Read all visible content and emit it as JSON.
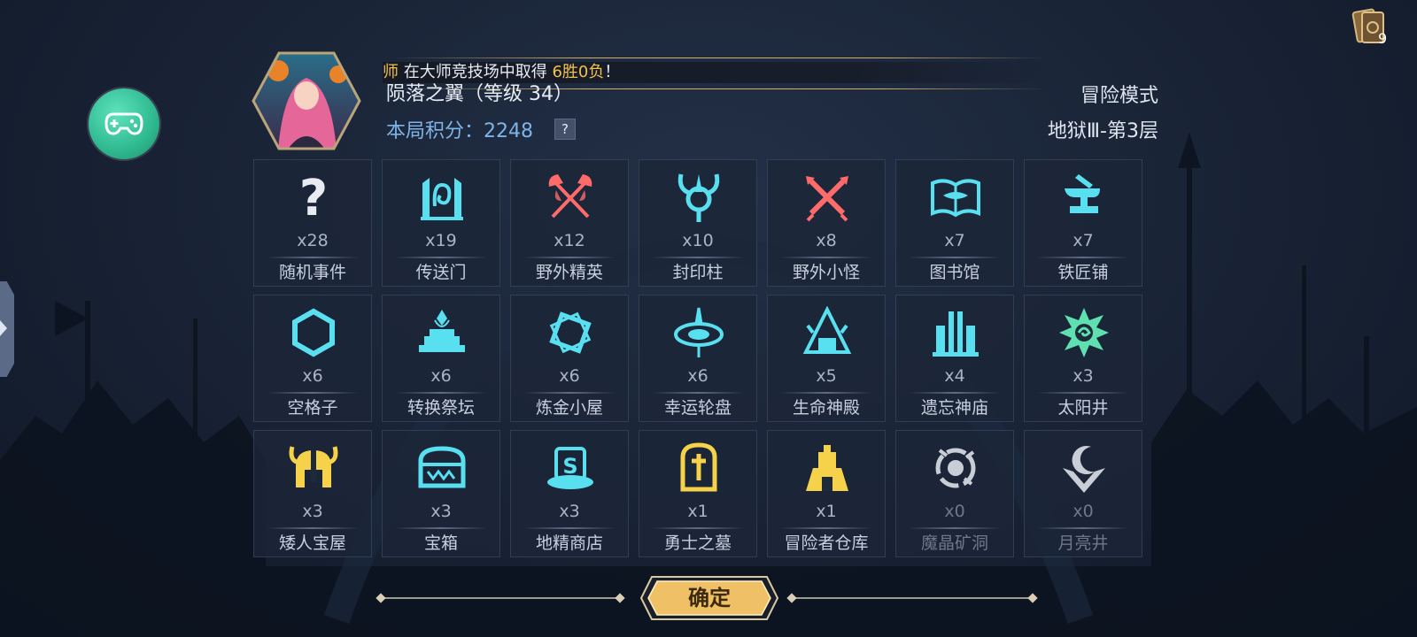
{
  "notification": {
    "prefix": "师",
    "text_mid": " 在大师竞技场中取得 ",
    "result": "6胜0负",
    "suffix": "！"
  },
  "header": {
    "title": "陨落之翼（等级 34）",
    "score_label": "本局积分：2248",
    "help_label": "?",
    "mode": "冒险模式",
    "floor": "地狱Ⅲ-第3层"
  },
  "top_right": {
    "card_count": "9",
    "icon": "card-deck-icon"
  },
  "tiles": [
    {
      "count": "x28",
      "name": "随机事件",
      "icon": "question-icon"
    },
    {
      "count": "x19",
      "name": "传送门",
      "icon": "portal-icon"
    },
    {
      "count": "x12",
      "name": "野外精英",
      "icon": "crossed-axes-icon"
    },
    {
      "count": "x10",
      "name": "封印柱",
      "icon": "seal-pillar-icon"
    },
    {
      "count": "x8",
      "name": "野外小怪",
      "icon": "crossed-swords-icon"
    },
    {
      "count": "x7",
      "name": "图书馆",
      "icon": "book-icon"
    },
    {
      "count": "x7",
      "name": "铁匠铺",
      "icon": "anvil-icon"
    },
    {
      "count": "x6",
      "name": "空格子",
      "icon": "hexagon-icon"
    },
    {
      "count": "x6",
      "name": "转换祭坛",
      "icon": "altar-icon"
    },
    {
      "count": "x6",
      "name": "炼金小屋",
      "icon": "alchemy-icon"
    },
    {
      "count": "x6",
      "name": "幸运轮盘",
      "icon": "roulette-icon"
    },
    {
      "count": "x5",
      "name": "生命神殿",
      "icon": "life-temple-icon"
    },
    {
      "count": "x4",
      "name": "遗忘神庙",
      "icon": "forgotten-temple-icon"
    },
    {
      "count": "x3",
      "name": "太阳井",
      "icon": "sun-well-icon"
    },
    {
      "count": "x3",
      "name": "矮人宝屋",
      "icon": "dwarf-helmet-icon"
    },
    {
      "count": "x3",
      "name": "宝箱",
      "icon": "chest-icon"
    },
    {
      "count": "x3",
      "name": "地精商店",
      "icon": "goblin-shop-icon"
    },
    {
      "count": "x1",
      "name": "勇士之墓",
      "icon": "tombstone-icon"
    },
    {
      "count": "x1",
      "name": "冒险者仓库",
      "icon": "warehouse-icon"
    },
    {
      "count": "x0",
      "name": "魔晶矿洞",
      "icon": "crystal-mine-icon"
    },
    {
      "count": "x0",
      "name": "月亮井",
      "icon": "moon-well-icon"
    }
  ],
  "colors": {
    "cyan": "#58e0f0",
    "red": "#ff6a6a",
    "gold": "#f5d24a",
    "silver": "#e8ecf2",
    "green": "#5fe0b0"
  },
  "confirm_label": "确定"
}
